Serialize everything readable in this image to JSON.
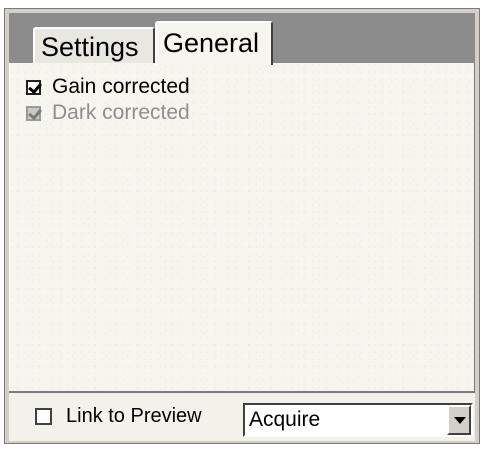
{
  "tabs": [
    {
      "label": "Settings",
      "active": false
    },
    {
      "label": "General",
      "active": true
    }
  ],
  "general": {
    "gain_corrected": {
      "label": "Gain corrected",
      "checked": true,
      "enabled": true
    },
    "dark_corrected": {
      "label": "Dark corrected",
      "checked": true,
      "enabled": false
    }
  },
  "bottom": {
    "link_to_preview": {
      "label": "Link to Preview",
      "checked": false
    },
    "mode_select": {
      "value": "Acquire"
    }
  },
  "icons": {
    "dropdown": "chevron-down-icon",
    "check": "checkmark-icon"
  },
  "colors": {
    "panel_bg": "#f6f5ee",
    "tab_strip": "#8c8c8c",
    "disabled_text": "#8f8f8f"
  }
}
